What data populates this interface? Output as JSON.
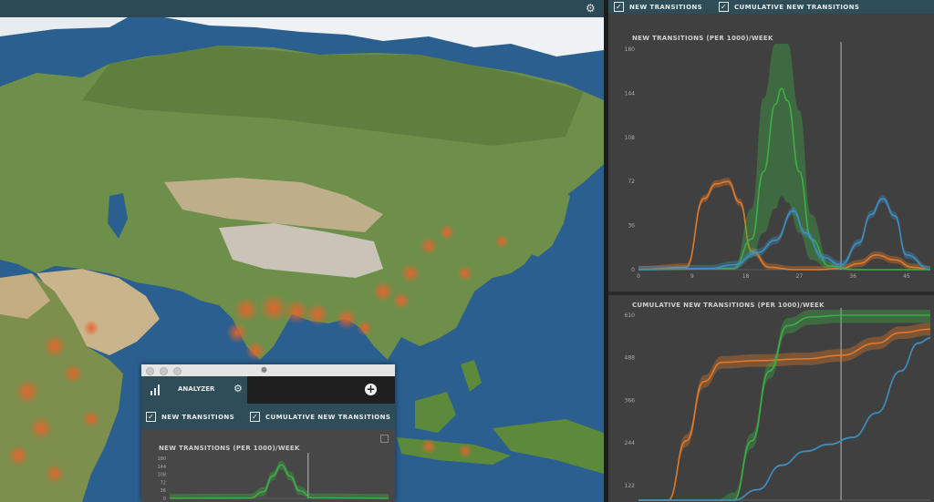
{
  "map": {
    "settings_icon": "gear-icon",
    "colors": {
      "ocean": "#2b5f8f",
      "land": "#6e8f4a",
      "desert": "#bfae8a",
      "mountain": "#c9c3b8",
      "ice": "#eef2f4",
      "hotspot": "#e8632c"
    }
  },
  "panel": {
    "checks": [
      {
        "label": "NEW TRANSITIONS",
        "checked": true
      },
      {
        "label": "CUMULATIVE NEW TRANSITIONS",
        "checked": true
      }
    ]
  },
  "analyzer": {
    "tab_label": "ANALYZER",
    "tab_icon": "bar-chart-icon",
    "settings_icon": "gear-icon",
    "add_icon": "plus-icon",
    "checks": [
      {
        "label": "NEW TRANSITIONS",
        "checked": true
      },
      {
        "label": "CUMULATIVE NEW TRANSITIONS",
        "checked": true
      }
    ],
    "expand_icon": "expand-icon"
  },
  "chart_data": [
    {
      "type": "line",
      "title": "NEW TRANSITIONS (PER 1000)/WEEK",
      "x_ticks": [
        0,
        9,
        18,
        27,
        36,
        45
      ],
      "y_ticks": [
        0,
        36,
        72,
        108,
        144,
        180
      ],
      "xlim": [
        0,
        49
      ],
      "ylim": [
        0,
        180
      ],
      "cursor_x": 34,
      "series": [
        {
          "color": "#e07a2a",
          "x": [
            0,
            8,
            11,
            13,
            15,
            17,
            19,
            22,
            26,
            30,
            34,
            37,
            40,
            43,
            46,
            49
          ],
          "y": [
            0,
            2,
            58,
            70,
            72,
            55,
            15,
            2,
            0,
            0,
            1,
            5,
            12,
            8,
            2,
            0
          ],
          "band": 3
        },
        {
          "color": "#3cae45",
          "x": [
            0,
            16,
            19,
            21,
            23,
            24,
            25,
            27,
            29,
            32,
            36,
            40,
            49
          ],
          "y": [
            0,
            1,
            25,
            80,
            135,
            148,
            138,
            80,
            25,
            3,
            0,
            0,
            0
          ],
          "band_upper": [
            0,
            2,
            50,
            140,
            210,
            235,
            215,
            130,
            45,
            6,
            1,
            0,
            0
          ],
          "band_lower": [
            0,
            0,
            10,
            30,
            50,
            60,
            55,
            30,
            8,
            1,
            0,
            0,
            0
          ]
        },
        {
          "color": "#3d8fc0",
          "x": [
            0,
            12,
            16,
            20,
            23,
            26,
            28,
            31,
            34,
            37,
            39,
            41,
            43,
            45,
            49
          ],
          "y": [
            0,
            1,
            4,
            14,
            24,
            48,
            30,
            10,
            4,
            22,
            45,
            58,
            44,
            12,
            0
          ],
          "band": 3
        }
      ]
    },
    {
      "type": "line",
      "title": "CUMULATIVE NEW TRANSITIONS (PER 1000)/WEEK",
      "y_ticks": [
        122,
        244,
        366,
        488,
        610
      ],
      "ylim": [
        80,
        610
      ],
      "xlim": [
        0,
        49
      ],
      "cursor_x": 34,
      "series": [
        {
          "color": "#e07a2a",
          "x": [
            0,
            5,
            8,
            11,
            14,
            20,
            28,
            34,
            40,
            44,
            49
          ],
          "y": [
            0,
            30,
            250,
            420,
            475,
            480,
            485,
            495,
            530,
            560,
            570
          ],
          "band": 18
        },
        {
          "color": "#3cae45",
          "x": [
            0,
            10,
            13,
            16,
            19,
            22,
            25,
            29,
            34,
            40,
            49
          ],
          "y": [
            0,
            0,
            10,
            80,
            250,
            450,
            580,
            605,
            610,
            610,
            610
          ],
          "band": 22
        },
        {
          "color": "#3d8fc0",
          "x": [
            0,
            12,
            16,
            20,
            24,
            28,
            32,
            36,
            40,
            44,
            47,
            49
          ],
          "y": [
            0,
            0,
            30,
            110,
            180,
            220,
            240,
            260,
            330,
            450,
            530,
            545
          ],
          "band": 3
        }
      ]
    },
    {
      "type": "line",
      "title": "NEW TRANSITIONS (PER 1000)/WEEK",
      "y_ticks": [
        0,
        36,
        72,
        108,
        144,
        180
      ],
      "ylim": [
        0,
        180
      ],
      "xlim": [
        0,
        49
      ],
      "cursor_x": 31,
      "series": [
        {
          "color": "#3cae45",
          "x": [
            0,
            18,
            21,
            23,
            25,
            27,
            29,
            32,
            49
          ],
          "y": [
            0,
            1,
            30,
            100,
            150,
            100,
            35,
            2,
            0
          ],
          "band": 20
        }
      ]
    }
  ]
}
